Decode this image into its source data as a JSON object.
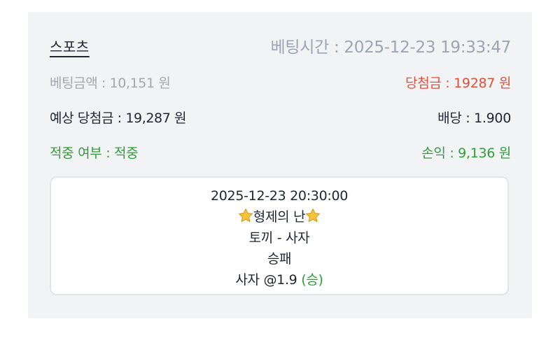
{
  "bet": {
    "category": "스포츠",
    "bet_time": "베팅시간 : 2025-12-23 19:33:47",
    "bet_amount": "베팅금액 : 10,151 원",
    "win_amount": "당첨금 : 19287 원",
    "expected_win": "예상 당첨금 : 19,287 원",
    "odds": "배당 : 1.900",
    "hit_status": "적중 여부 : 적중",
    "profit": "손익 : 9,136 원"
  },
  "detail": {
    "match_time": "2025-12-23 20:30:00",
    "league_name": "형제의 난",
    "league_icon": "star-icon",
    "teams": "토끼 - 사자",
    "market": "승패",
    "pick": "사자 @1.9",
    "pick_result": "(승)"
  },
  "colors": {
    "card_background": "#f2f3f5",
    "win_red": "#e3503a",
    "success_green": "#2f9e3a",
    "muted_gray": "#9ba5b4",
    "text_dark": "#1f2533"
  }
}
